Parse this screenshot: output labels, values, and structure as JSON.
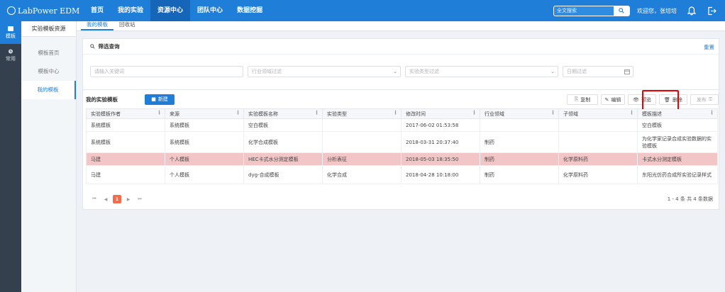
{
  "app": {
    "logo": "LabPower EDM"
  },
  "nav": [
    "首页",
    "我的实验",
    "资源中心",
    "团队中心",
    "数据挖掘"
  ],
  "search": {
    "placeholder": "全文搜索"
  },
  "user": {
    "welcome": "欢迎您，张培培"
  },
  "rail": [
    {
      "label": "模板"
    },
    {
      "label": "常用"
    }
  ],
  "sidebar": {
    "title": "实验模板资源",
    "items": [
      "模板首页",
      "模板中心",
      "我的模板"
    ]
  },
  "tabs": [
    "我的模板",
    "回收站"
  ],
  "filter": {
    "title": "筛选查询",
    "reset": "重置",
    "keyword_placeholder": "请输入关键词",
    "industry_placeholder": "行业领域过滤",
    "type_placeholder": "实验类型过滤",
    "date_placeholder": "日期过滤"
  },
  "table": {
    "title": "我的实验模板",
    "new_label": "新建",
    "actions": {
      "copy": "复制",
      "edit": "编辑",
      "preview": "预览",
      "delete": "删除",
      "publish": "发布"
    },
    "columns": [
      "实验模板作者",
      "来源",
      "实验模板名称",
      "实验类型",
      "修改时间",
      "行业领域",
      "子领域",
      "模板描述"
    ],
    "rows": [
      [
        "系统模板",
        "系统模板",
        "空白模板",
        "",
        "2017-06-02 01:53:58",
        "",
        "",
        "空白模板"
      ],
      [
        "系统模板",
        "系统模板",
        "化学合成模板",
        "",
        "2018-03-31 20:37:40",
        "制药",
        "",
        "为化学家记录合成实验数据的实验模板"
      ],
      [
        "马建",
        "个人模板",
        "HEC卡式水分测定模板",
        "分析表征",
        "2018-05-03 18:35:50",
        "制药",
        "化学原料药",
        "卡式水分测定模板"
      ],
      [
        "马建",
        "个人模板",
        "dyg-合成模板",
        "化学合成",
        "2018-04-28 10:18:00",
        "制药",
        "化学原料药",
        "东阳光仿药合成所实验记录样式"
      ]
    ]
  },
  "pager": {
    "current": "1",
    "summary": "1 - 4 条   共 4 条数据"
  },
  "colors": {
    "primary": "#1f7fd8",
    "selected_row": "#f2c6c6",
    "highlight": "#ee0000"
  }
}
